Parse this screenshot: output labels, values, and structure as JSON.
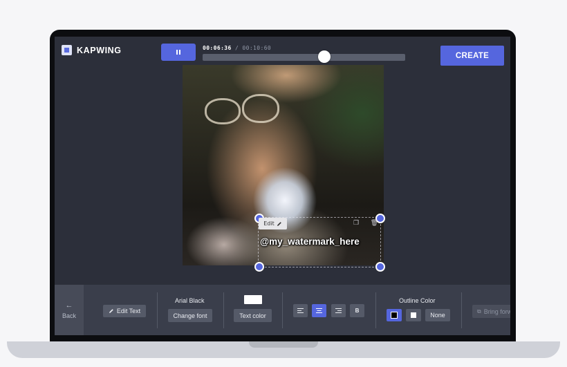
{
  "app": {
    "name": "KAPWING"
  },
  "player": {
    "play_icon": "pause-icon",
    "current_time": "00:06:36",
    "separator": "/",
    "total_time": "00:10:60"
  },
  "header": {
    "create_label": "CREATE"
  },
  "overlay": {
    "edit_label": "Edit",
    "watermark_text": "@my_watermark_here"
  },
  "toolbar": {
    "back_label": "Back",
    "edit_text_label": "Edit Text",
    "font_name": "Arial Black",
    "change_font_label": "Change font",
    "text_color_label": "Text color",
    "text_color_value": "#ffffff",
    "bold_label": "B",
    "outline_label": "Outline Color",
    "none_label": "None",
    "bring_forward_label": "Bring forward"
  },
  "colors": {
    "accent": "#5566de",
    "toolbar_bg": "#3a3e4b",
    "canvas_bg": "#2c2f3a"
  }
}
